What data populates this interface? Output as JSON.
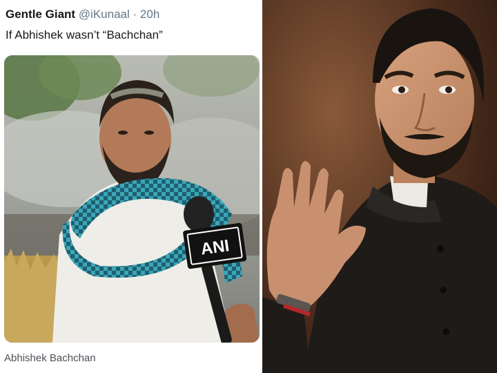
{
  "tweet": {
    "name": "Gentle Giant",
    "handle": "@iKunaal",
    "separator": "·",
    "time": "20h",
    "text": "If Abhishek wasn’t “Bachchan”",
    "media": {
      "logo_text": "ANI"
    },
    "caption": "Abhishek Bachchan"
  },
  "colors": {
    "name": "#14171a",
    "meta": "#657786",
    "scarf": "#3aa6b9",
    "mic_badge": "#111111"
  }
}
